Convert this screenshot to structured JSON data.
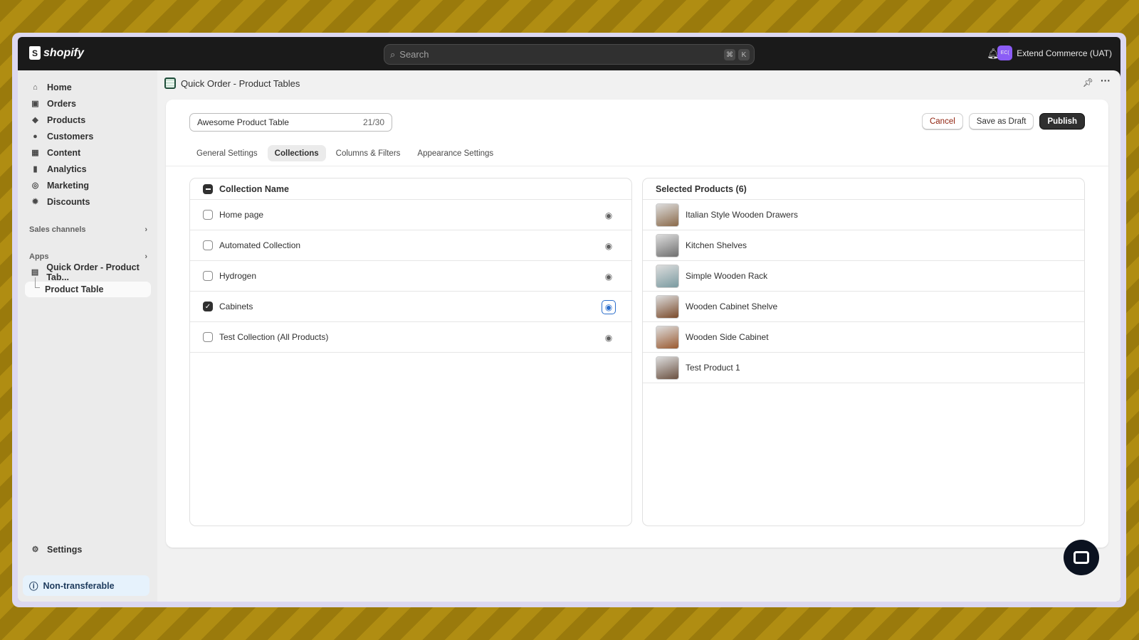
{
  "topbar": {
    "brand": "shopify",
    "search_placeholder": "Search",
    "shortcut": [
      "⌘",
      "K"
    ],
    "account_initials": "EC(",
    "account_name": "Extend Commerce (UAT)"
  },
  "sidebar": {
    "items": [
      {
        "label": "Home",
        "icon": "home-icon"
      },
      {
        "label": "Orders",
        "icon": "orders-icon"
      },
      {
        "label": "Products",
        "icon": "tag-icon"
      },
      {
        "label": "Customers",
        "icon": "person-icon"
      },
      {
        "label": "Content",
        "icon": "content-icon"
      },
      {
        "label": "Analytics",
        "icon": "chart-icon"
      },
      {
        "label": "Marketing",
        "icon": "target-icon"
      },
      {
        "label": "Discounts",
        "icon": "discount-icon"
      }
    ],
    "sales_channels": "Sales channels",
    "apps": "Apps",
    "app_name": "Quick Order - Product Tab...",
    "app_sub": "Product Table",
    "settings": "Settings",
    "non_transferable": "Non-transferable"
  },
  "page": {
    "title": "Quick Order - Product Tables",
    "name_value": "Awesome Product Table",
    "name_count": "21/30",
    "cancel": "Cancel",
    "save_draft": "Save as Draft",
    "publish": "Publish",
    "tabs": [
      {
        "label": "General Settings",
        "active": false
      },
      {
        "label": "Collections",
        "active": true
      },
      {
        "label": "Columns & Filters",
        "active": false
      },
      {
        "label": "Appearance Settings",
        "active": false
      }
    ]
  },
  "collections": {
    "header": "Collection Name",
    "rows": [
      {
        "name": "Home page",
        "checked": false
      },
      {
        "name": "Automated Collection",
        "checked": false
      },
      {
        "name": "Hydrogen",
        "checked": false
      },
      {
        "name": "Cabinets",
        "checked": true
      },
      {
        "name": "Test Collection (All Products)",
        "checked": false
      }
    ]
  },
  "products": {
    "header": "Selected Products (6)",
    "rows": [
      {
        "name": "Italian Style Wooden Drawers",
        "color": "#8a6a4a"
      },
      {
        "name": "Kitchen Shelves",
        "color": "#6f6f6f"
      },
      {
        "name": "Simple Wooden Rack",
        "color": "#7a9aa0"
      },
      {
        "name": "Wooden Cabinet Shelve",
        "color": "#7a4a2a"
      },
      {
        "name": "Wooden Side Cabinet",
        "color": "#9a5a30"
      },
      {
        "name": "Test Product 1",
        "color": "#6a5040"
      }
    ]
  },
  "colors": {
    "accent": "#2c6ecb",
    "primary_button": "#303030",
    "cancel_text": "#8e1f0b"
  }
}
